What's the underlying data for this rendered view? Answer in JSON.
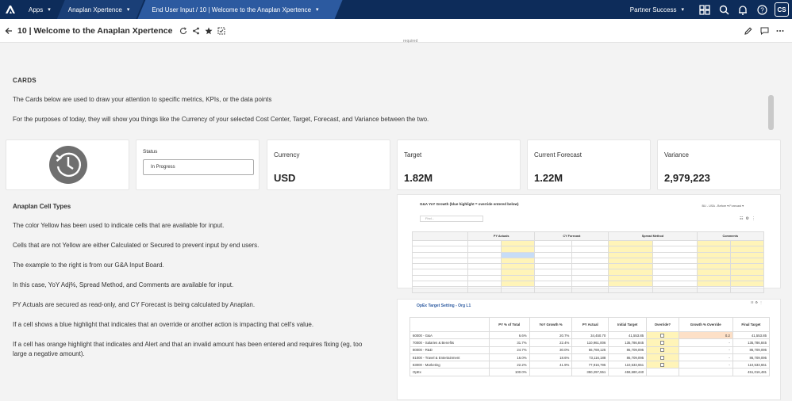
{
  "topbar": {
    "apps_label": "Apps",
    "xperience_label": "Anaplan Xpertence",
    "page_label": "End User Input / 10 | Welcome to the Anaplan Xpertence",
    "partner_label": "Partner Success",
    "avatar_initials": "CS"
  },
  "header": {
    "title": "10 | Welcome to the Anaplan Xpertence"
  },
  "content": {
    "top_fragment": "required",
    "cards_heading": "CARDS",
    "cards_desc_1": "The Cards below are used to draw your attention to specific metrics, KPIs, or the data points",
    "cards_desc_2": "For the purposes of today, they will show you things like the Currency of your selected Cost Center, Target, Forecast, and Variance between the two.",
    "cell_types_heading": "Anaplan Cell Types",
    "lines": [
      "The color Yellow has been used to indicate cells that are available for input.",
      "Cells that are not Yellow are either Calculated or Secured to prevent input by end users.",
      "The example to the right is from our G&A Input Board.",
      "In this case, YoY Adj%, Spread Method, and Comments are available for input.",
      "PY Actuals are secured as read-only, and CY Forecast is being calculated by Anaplan.",
      "If a cell shows a blue highlight that indicates that an override or another action is impacting that cell's value.",
      "If a cell has orange highlight that indicates and Alert and that an invalid amount has been entered and requires fixing (eg, too",
      "large a negative amount)."
    ]
  },
  "cards": {
    "status_label": "Status",
    "status_value": "In Progress",
    "currency_label": "Currency",
    "currency_value": "USD",
    "target_label": "Target",
    "target_value": "1.82M",
    "forecast_label": "Current Forecast",
    "forecast_value": "1.22M",
    "variance_label": "Variance",
    "variance_value": "2,979,223"
  },
  "mini1": {
    "title": "G&A YoY Growth (blue highlight = override entered below)",
    "find_placeholder": "Find...",
    "meta": "BU - USA - Before ▾   Forecast ▾",
    "columns": [
      "",
      "PY Actuals",
      "",
      "CY Forecast",
      "",
      "Spread Method",
      "",
      "Comments"
    ]
  },
  "mini2": {
    "title": "OpEx Target Setting - Org L1",
    "columns": [
      "",
      "PY % of Total",
      "YoY Growth %",
      "PY Actual",
      "Initial Target",
      "Override?",
      "Growth % Override",
      "Final Target"
    ],
    "rows": [
      {
        "name": "60000 - G&A",
        "pct": "6.6%",
        "yoy": "20.7%",
        "py": "34,450.70",
        "init": "41,553.85",
        "ovr": "0.2",
        "final": "41,553.85"
      },
      {
        "name": "70000 - Salaries & Benefits",
        "pct": "31.7%",
        "yoy": "22.4%",
        "py": "110,961,006",
        "init": "135,786,845",
        "ovr": "-",
        "final": "135,786,845"
      },
      {
        "name": "80000 - R&D",
        "pct": "24.7%",
        "yoy": "30.0%",
        "py": "66,769,125",
        "init": "86,709,095",
        "ovr": "-",
        "final": "86,709,095"
      },
      {
        "name": "81000 - Travel & Entertainment",
        "pct": "16.0%",
        "yoy": "18.6%",
        "py": "73,116,188",
        "init": "86,709,095",
        "ovr": "-",
        "final": "86,709,095"
      },
      {
        "name": "83000 - Marketing",
        "pct": "22.2%",
        "yoy": "41.9%",
        "py": "77,916,795",
        "init": "110,533,651",
        "ovr": "-",
        "final": "110,533,651"
      },
      {
        "name": "OpEx",
        "pct": "100.0%",
        "yoy": "",
        "py": "350,297,551",
        "init": "459,680,440",
        "ovr": "",
        "final": "451,016,481"
      }
    ]
  }
}
